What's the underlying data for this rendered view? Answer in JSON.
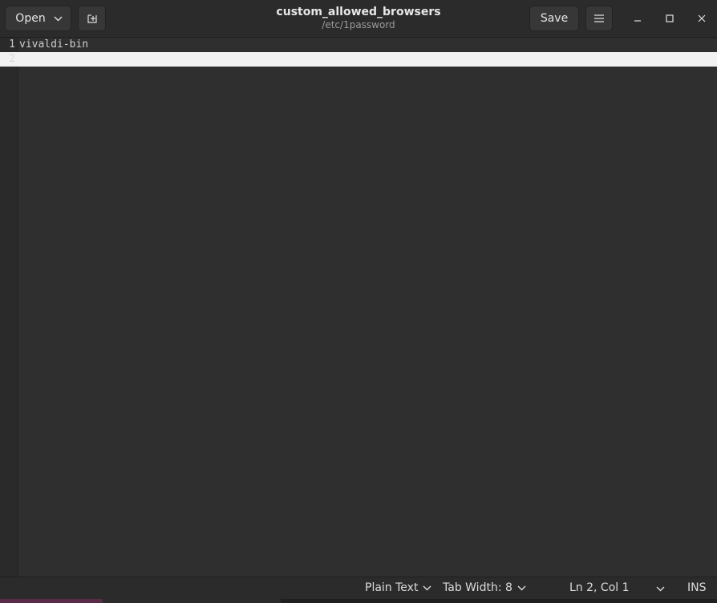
{
  "header": {
    "open_label": "Open",
    "title": "custom_allowed_browsers",
    "subtitle": "/etc/1password",
    "save_label": "Save"
  },
  "editor": {
    "lines": [
      {
        "number": "1",
        "text": "vivaldi-bin"
      },
      {
        "number": "2",
        "text": ""
      }
    ]
  },
  "statusbar": {
    "language": "Plain Text",
    "tab_width": "Tab Width: 8",
    "position": "Ln 2, Col 1",
    "mode": "INS"
  },
  "colors": {
    "background": "#2f2f2f",
    "current_line": "#f2f2f2",
    "text": "#cfcfcf"
  },
  "icons": [
    "chevron-down-icon",
    "new-tab-icon",
    "hamburger-menu-icon",
    "minimize-icon",
    "maximize-icon",
    "close-icon"
  ]
}
